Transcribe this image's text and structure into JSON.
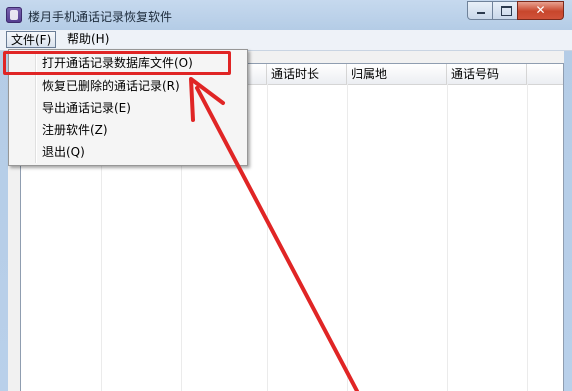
{
  "window": {
    "title": "楼月手机通话记录恢复软件",
    "close_glyph": "✕"
  },
  "menubar": {
    "file": "文件(F)",
    "help": "帮助(H)"
  },
  "file_menu": {
    "items": [
      "打开通话记录数据库文件(O)",
      "恢复已删除的通话记录(R)",
      "导出通话记录(E)",
      "注册软件(Z)",
      "退出(Q)"
    ]
  },
  "table": {
    "columns": [
      "通话时长",
      "归属地",
      "通话号码"
    ]
  },
  "icons": {
    "app": "phone-app-icon",
    "minimize": "minimize-icon",
    "maximize": "maximize-icon",
    "close": "close-icon"
  },
  "colors": {
    "annotation": "#e02525",
    "titlebar": "#b9d0ea"
  }
}
